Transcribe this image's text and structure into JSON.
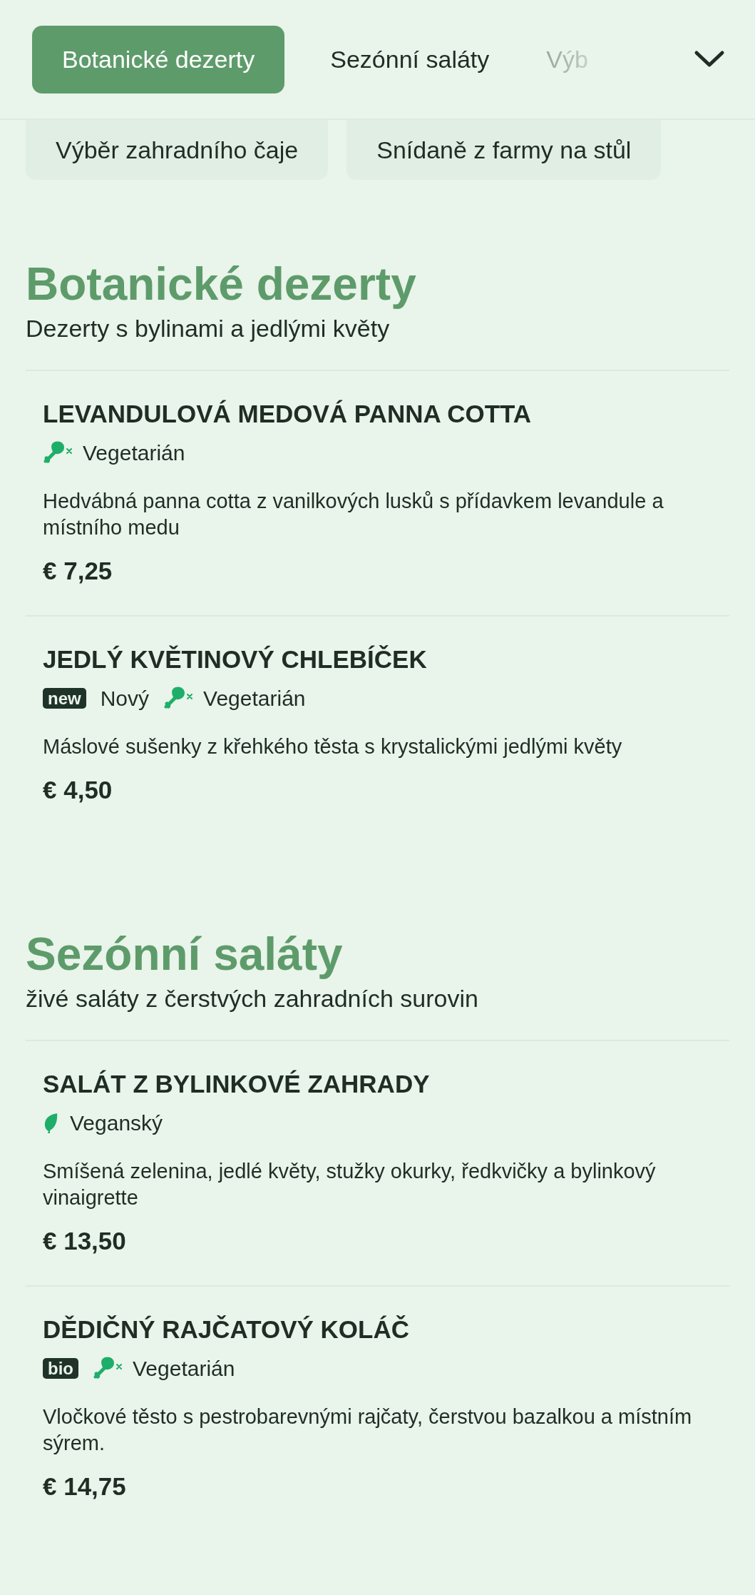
{
  "tabs": [
    {
      "label": "Botanické dezerty",
      "selected": true
    },
    {
      "label": "Sezónní saláty",
      "selected": false
    },
    {
      "label": "Výb",
      "selected": false
    }
  ],
  "categories": [
    "Výběr zahradního čaje",
    "Snídaně z farmy na stůl"
  ],
  "sections": [
    {
      "title": "Botanické dezerty",
      "subtitle": "Dezerty s bylinami a jedlými květy",
      "items": [
        {
          "name": "LEVANDULOVÁ MEDOVÁ PANNA COTTA",
          "tags": [
            {
              "kind": "vegetarian",
              "text": "Vegetarián"
            }
          ],
          "description": "Hedvábná panna cotta z vanilkových lusků s přídavkem levandule a místního medu",
          "price": "€ 7,25"
        },
        {
          "name": "JEDLÝ KVĚTINOVÝ CHLEBÍČEK",
          "tags": [
            {
              "kind": "badge",
              "badge": "new",
              "text": "Nový"
            },
            {
              "kind": "vegetarian",
              "text": "Vegetarián"
            }
          ],
          "description": "Máslové sušenky z křehkého těsta s krystalickými jedlými květy",
          "price": "€ 4,50"
        }
      ]
    },
    {
      "title": "Sezónní saláty",
      "subtitle": "živé saláty z čerstvých zahradních surovin",
      "items": [
        {
          "name": "SALÁT Z BYLINKOVÉ ZAHRADY",
          "tags": [
            {
              "kind": "vegan",
              "text": "Veganský"
            }
          ],
          "description": "Smíšená zelenina, jedlé květy, stužky okurky, ředkvičky a bylinkový vinaigrette",
          "price": "€ 13,50"
        },
        {
          "name": "DĚDIČNÝ RAJČATOVÝ KOLÁČ",
          "tags": [
            {
              "kind": "badge",
              "badge": "bio"
            },
            {
              "kind": "vegetarian",
              "text": "Vegetarián"
            }
          ],
          "description": "Vločkové těsto s pestrobarevnými rajčaty, čerstvou bazalkou a místním sýrem.",
          "price": "€ 14,75"
        }
      ]
    }
  ]
}
